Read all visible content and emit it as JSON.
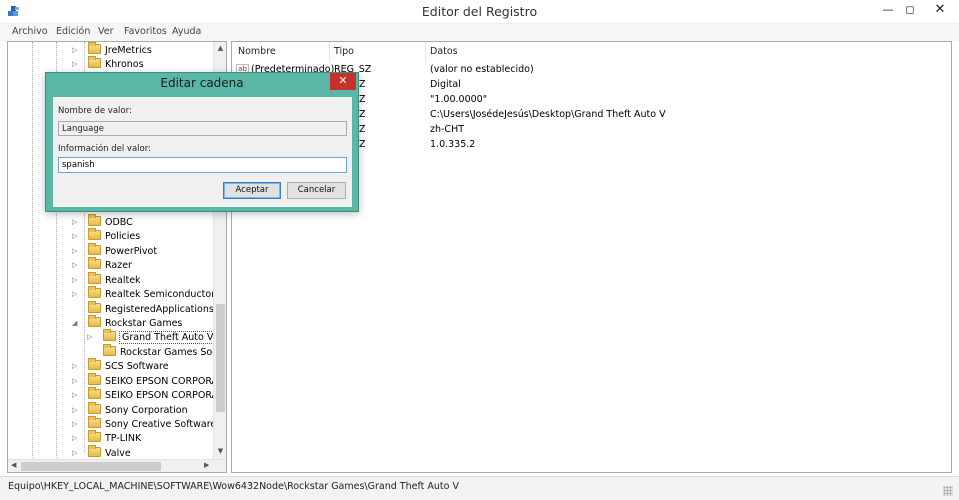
{
  "window": {
    "title": "Editor del Registro",
    "min_icon": "minimize-icon",
    "max_icon": "maximize-icon",
    "close_icon": "close-icon",
    "min_glyph": "—",
    "max_glyph": "◻",
    "close_glyph": "✕"
  },
  "menu": [
    "Archivo",
    "Edición",
    "Ver",
    "Favoritos",
    "Ayuda"
  ],
  "tree": {
    "items": [
      {
        "label": "JreMetrics",
        "expand": "▷"
      },
      {
        "label": "Khronos",
        "expand": "▷"
      },
      {
        "label": "ODBC",
        "expand": "▷"
      },
      {
        "label": "Policies",
        "expand": "▷"
      },
      {
        "label": "PowerPivot",
        "expand": "▷"
      },
      {
        "label": "Razer",
        "expand": "▷"
      },
      {
        "label": "Realtek",
        "expand": "▷"
      },
      {
        "label": "Realtek Semiconductor Co",
        "expand": "▷"
      },
      {
        "label": "RegisteredApplications",
        "expand": ""
      },
      {
        "label": "Rockstar Games",
        "expand": "◢"
      },
      {
        "label": "Grand Theft Auto V",
        "expand": "▷"
      },
      {
        "label": "Rockstar Games Social",
        "expand": ""
      },
      {
        "label": "SCS Software",
        "expand": "▷"
      },
      {
        "label": "SEIKO EPSON CORPORAT",
        "expand": "▷"
      },
      {
        "label": "SEIKO EPSON CORPORAT",
        "expand": "▷"
      },
      {
        "label": "Sony Corporation",
        "expand": "▷"
      },
      {
        "label": "Sony Creative Software",
        "expand": "▷"
      },
      {
        "label": "TP-LINK",
        "expand": "▷"
      },
      {
        "label": "Valve",
        "expand": "▷"
      }
    ],
    "scroll_up": "▲",
    "scroll_down": "▼",
    "scroll_left": "◀",
    "scroll_right": "▶"
  },
  "list": {
    "columns": [
      "Nombre",
      "Tipo",
      "Datos"
    ],
    "rows": [
      {
        "name": "(Predeterminado)",
        "type": "REG_SZ",
        "data": "(valor no establecido)"
      },
      {
        "name": "",
        "type": "Z",
        "data": "Digital"
      },
      {
        "name": "",
        "type": "Z",
        "data": "\"1.00.0000\""
      },
      {
        "name": "",
        "type": "Z",
        "data": "C:\\Users\\JosédeJesús\\Desktop\\Grand Theft Auto V"
      },
      {
        "name": "",
        "type": "Z",
        "data": "zh-CHT"
      },
      {
        "name": "",
        "type": "Z",
        "data": "1.0.335.2"
      }
    ],
    "value_icon_text": "ab"
  },
  "dialog": {
    "title": "Editar cadena",
    "close_glyph": "✕",
    "name_label": "Nombre de valor:",
    "name_value": "Language",
    "data_label": "Información del valor:",
    "data_value": "spanish",
    "ok_label": "Aceptar",
    "cancel_label": "Cancelar"
  },
  "status": {
    "path": "Equipo\\HKEY_LOCAL_MACHINE\\SOFTWARE\\Wow6432Node\\Rockstar Games\\Grand Theft Auto V"
  }
}
